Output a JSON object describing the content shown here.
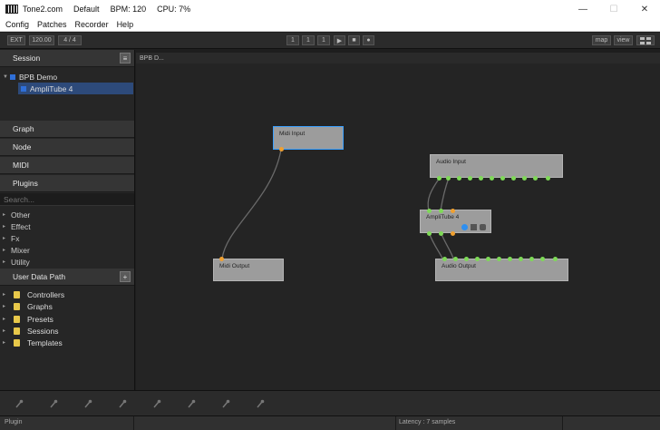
{
  "titlebar": {
    "segments": [
      "Tone2.com",
      "Default",
      "BPM: 120",
      "CPU: 7%"
    ],
    "minimize": "—",
    "maximize": "☐",
    "close": "✕"
  },
  "menu": [
    "Config",
    "Patches",
    "Recorder",
    "Help"
  ],
  "toolbar": {
    "ext": "EXT",
    "tempo": "120.00",
    "signature": "4 / 4",
    "position": [
      "1",
      "1",
      "1"
    ],
    "play": "▶",
    "stop": "■",
    "record": "●",
    "map": "map",
    "view": "view"
  },
  "session": {
    "header": "Session",
    "menu_icon": "≡",
    "project": "BPB Demo",
    "plugin": "AmpliTube 4"
  },
  "sections": [
    "Graph",
    "Node",
    "MIDI",
    "Plugins"
  ],
  "search": {
    "placeholder": "Search..."
  },
  "plugin_categories": [
    "Other",
    "Effect",
    "Fx",
    "Mixer",
    "Utility"
  ],
  "user_data": {
    "header": "User Data Path",
    "add": "+",
    "folders": [
      "Controllers",
      "Graphs",
      "Presets",
      "Sessions",
      "Templates"
    ]
  },
  "canvas": {
    "tab": "BPB D...",
    "nodes": {
      "midi_input": "Midi Input",
      "audio_input": "Audio Input",
      "amplitube": "AmpliTube 4",
      "midi_output": "Midi Output",
      "audio_output": "Audio Output"
    }
  },
  "status": {
    "left": "Plugin",
    "latency": "Latency : 7 samples"
  },
  "colors": {
    "accent_blue": "#2f6fd8",
    "pin_green": "#7ed957",
    "pin_orange": "#f0a030",
    "selection": "#3aa0ff"
  }
}
